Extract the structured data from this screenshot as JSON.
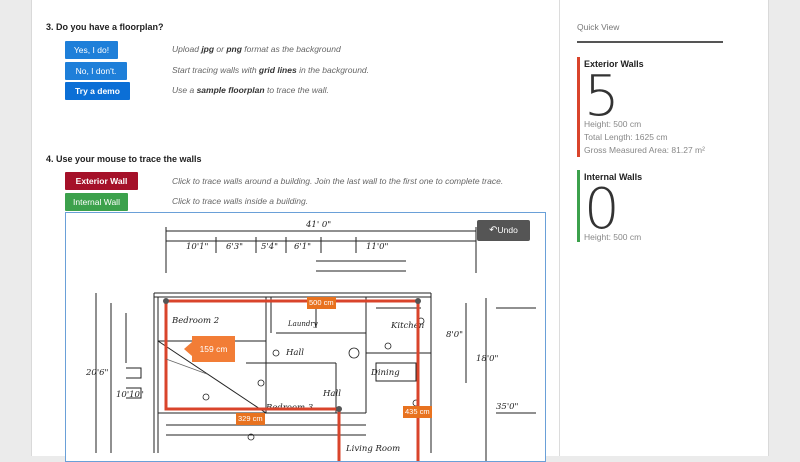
{
  "step3": {
    "heading": "3. Do you have a floorplan?",
    "yes_label": "Yes, I do!",
    "no_label": "No, I don't.",
    "demo_label": "Try a demo",
    "yes_hint": {
      "pre": "Upload ",
      "b1": "jpg",
      "mid": " or ",
      "b2": "png",
      "post": " format as the background"
    },
    "no_hint": {
      "pre": "Start tracing walls with ",
      "b1": "grid lines",
      "post": " in the background."
    },
    "demo_hint": {
      "pre": "Use a ",
      "b1": "sample floorplan",
      "post": " to trace the wall."
    }
  },
  "step4": {
    "heading": "4. Use your mouse to trace the walls",
    "exterior_label": "Exterior Wall",
    "internal_label": "Internal Wall",
    "exterior_hint": "Click to trace walls around a building. Join the last wall to the first one to complete trace.",
    "internal_hint": "Click to trace walls inside a building."
  },
  "canvas": {
    "undo_icon": "undo-icon",
    "undo_label": "Undo",
    "wall_color": "#d9442b",
    "tags": {
      "top": "500 cm",
      "bottom": "329 cm",
      "right": "435 cm",
      "active": "159 cm"
    },
    "floorplan_text": {
      "dim_top": "41' 0\"",
      "dim_a": "10'1\"",
      "dim_b": "6'3\"",
      "dim_c": "5'4\"",
      "dim_d": "6'1\"",
      "dim_e": "11'0\"",
      "room_bed2": "Bedroom 2",
      "room_laundry": "Laundry",
      "room_kitchen": "Kitchen",
      "room_hall": "Hall",
      "room_dining": "Dining",
      "room_hall2": "Hall",
      "room_bed3": "Bedroom 3",
      "room_living": "Living Room",
      "dim_left": "20'6\"",
      "dim_left2": "10'10\"",
      "dim_right": "18'0\"",
      "dim_right2": "35'0\"",
      "dim_r3": "8'0\""
    }
  },
  "quick_view": {
    "title": "Quick View",
    "exterior": {
      "title": "Exterior Walls",
      "count": "5",
      "height": "Height: 500 cm",
      "length": "Total Length: 1625 cm",
      "area": "Gross Measured Area: 81.27 m²",
      "color": "#d9442b"
    },
    "internal": {
      "title": "Internal Walls",
      "count": "0",
      "height": "Height: 500 cm",
      "color": "#3ca14c"
    }
  }
}
